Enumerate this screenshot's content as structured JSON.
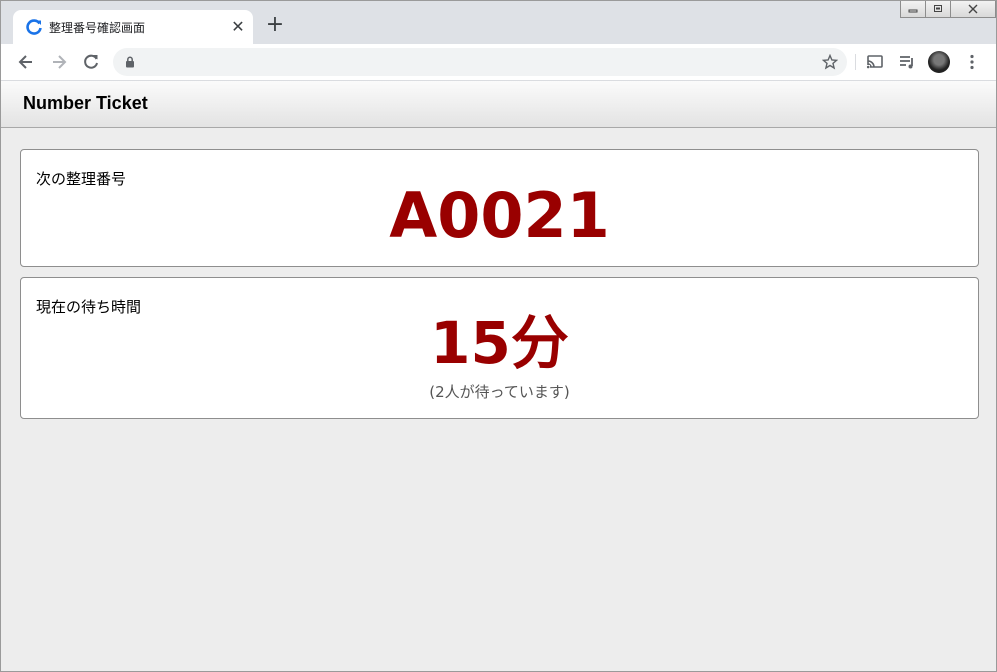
{
  "browser": {
    "tab_title": "整理番号確認画面",
    "new_tab_symbol": "+",
    "close_symbol": "✕",
    "url": ""
  },
  "page": {
    "title": "Number Ticket"
  },
  "next_ticket": {
    "label": "次の整理番号",
    "value": "A0021"
  },
  "wait_time": {
    "label": "現在の待ち時間",
    "value": "15分",
    "note": "(2人が待っています)"
  },
  "colors": {
    "accent": "#990000",
    "tab_strip": "#dee1e6",
    "page_bg": "#ededed"
  }
}
